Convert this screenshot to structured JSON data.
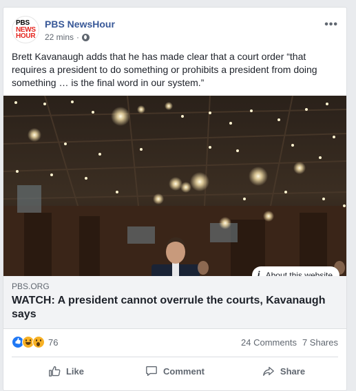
{
  "post": {
    "page_name": "PBS NewsHour",
    "avatar": {
      "line1": "PBS",
      "line2": "NEWS",
      "line3": "HOUR"
    },
    "time": "22 mins",
    "privacy_icon": "globe-icon",
    "more_icon": "more-options-icon",
    "more_label": "•••",
    "text": "Brett Kavanaugh adds that he has made clear that a court order “that requires a president to do something or prohibits a president from doing something … is the final word in our system.”"
  },
  "link": {
    "about_label": "About this website",
    "about_icon": "i",
    "domain": "PBS.ORG",
    "headline": "WATCH: A president cannot overrule the courts, Kavanaugh says"
  },
  "stats": {
    "reaction_icons": [
      "like-reaction-icon",
      "haha-reaction-icon",
      "wow-reaction-icon"
    ],
    "reaction_count": "76",
    "comments": "24 Comments",
    "shares": "7 Shares"
  },
  "actions": {
    "like": "Like",
    "comment": "Comment",
    "share": "Share"
  },
  "colors": {
    "page_name": "#385898",
    "secondary_text": "#606770",
    "link_bg": "#f2f3f5",
    "like_blue": "#2078f4"
  }
}
